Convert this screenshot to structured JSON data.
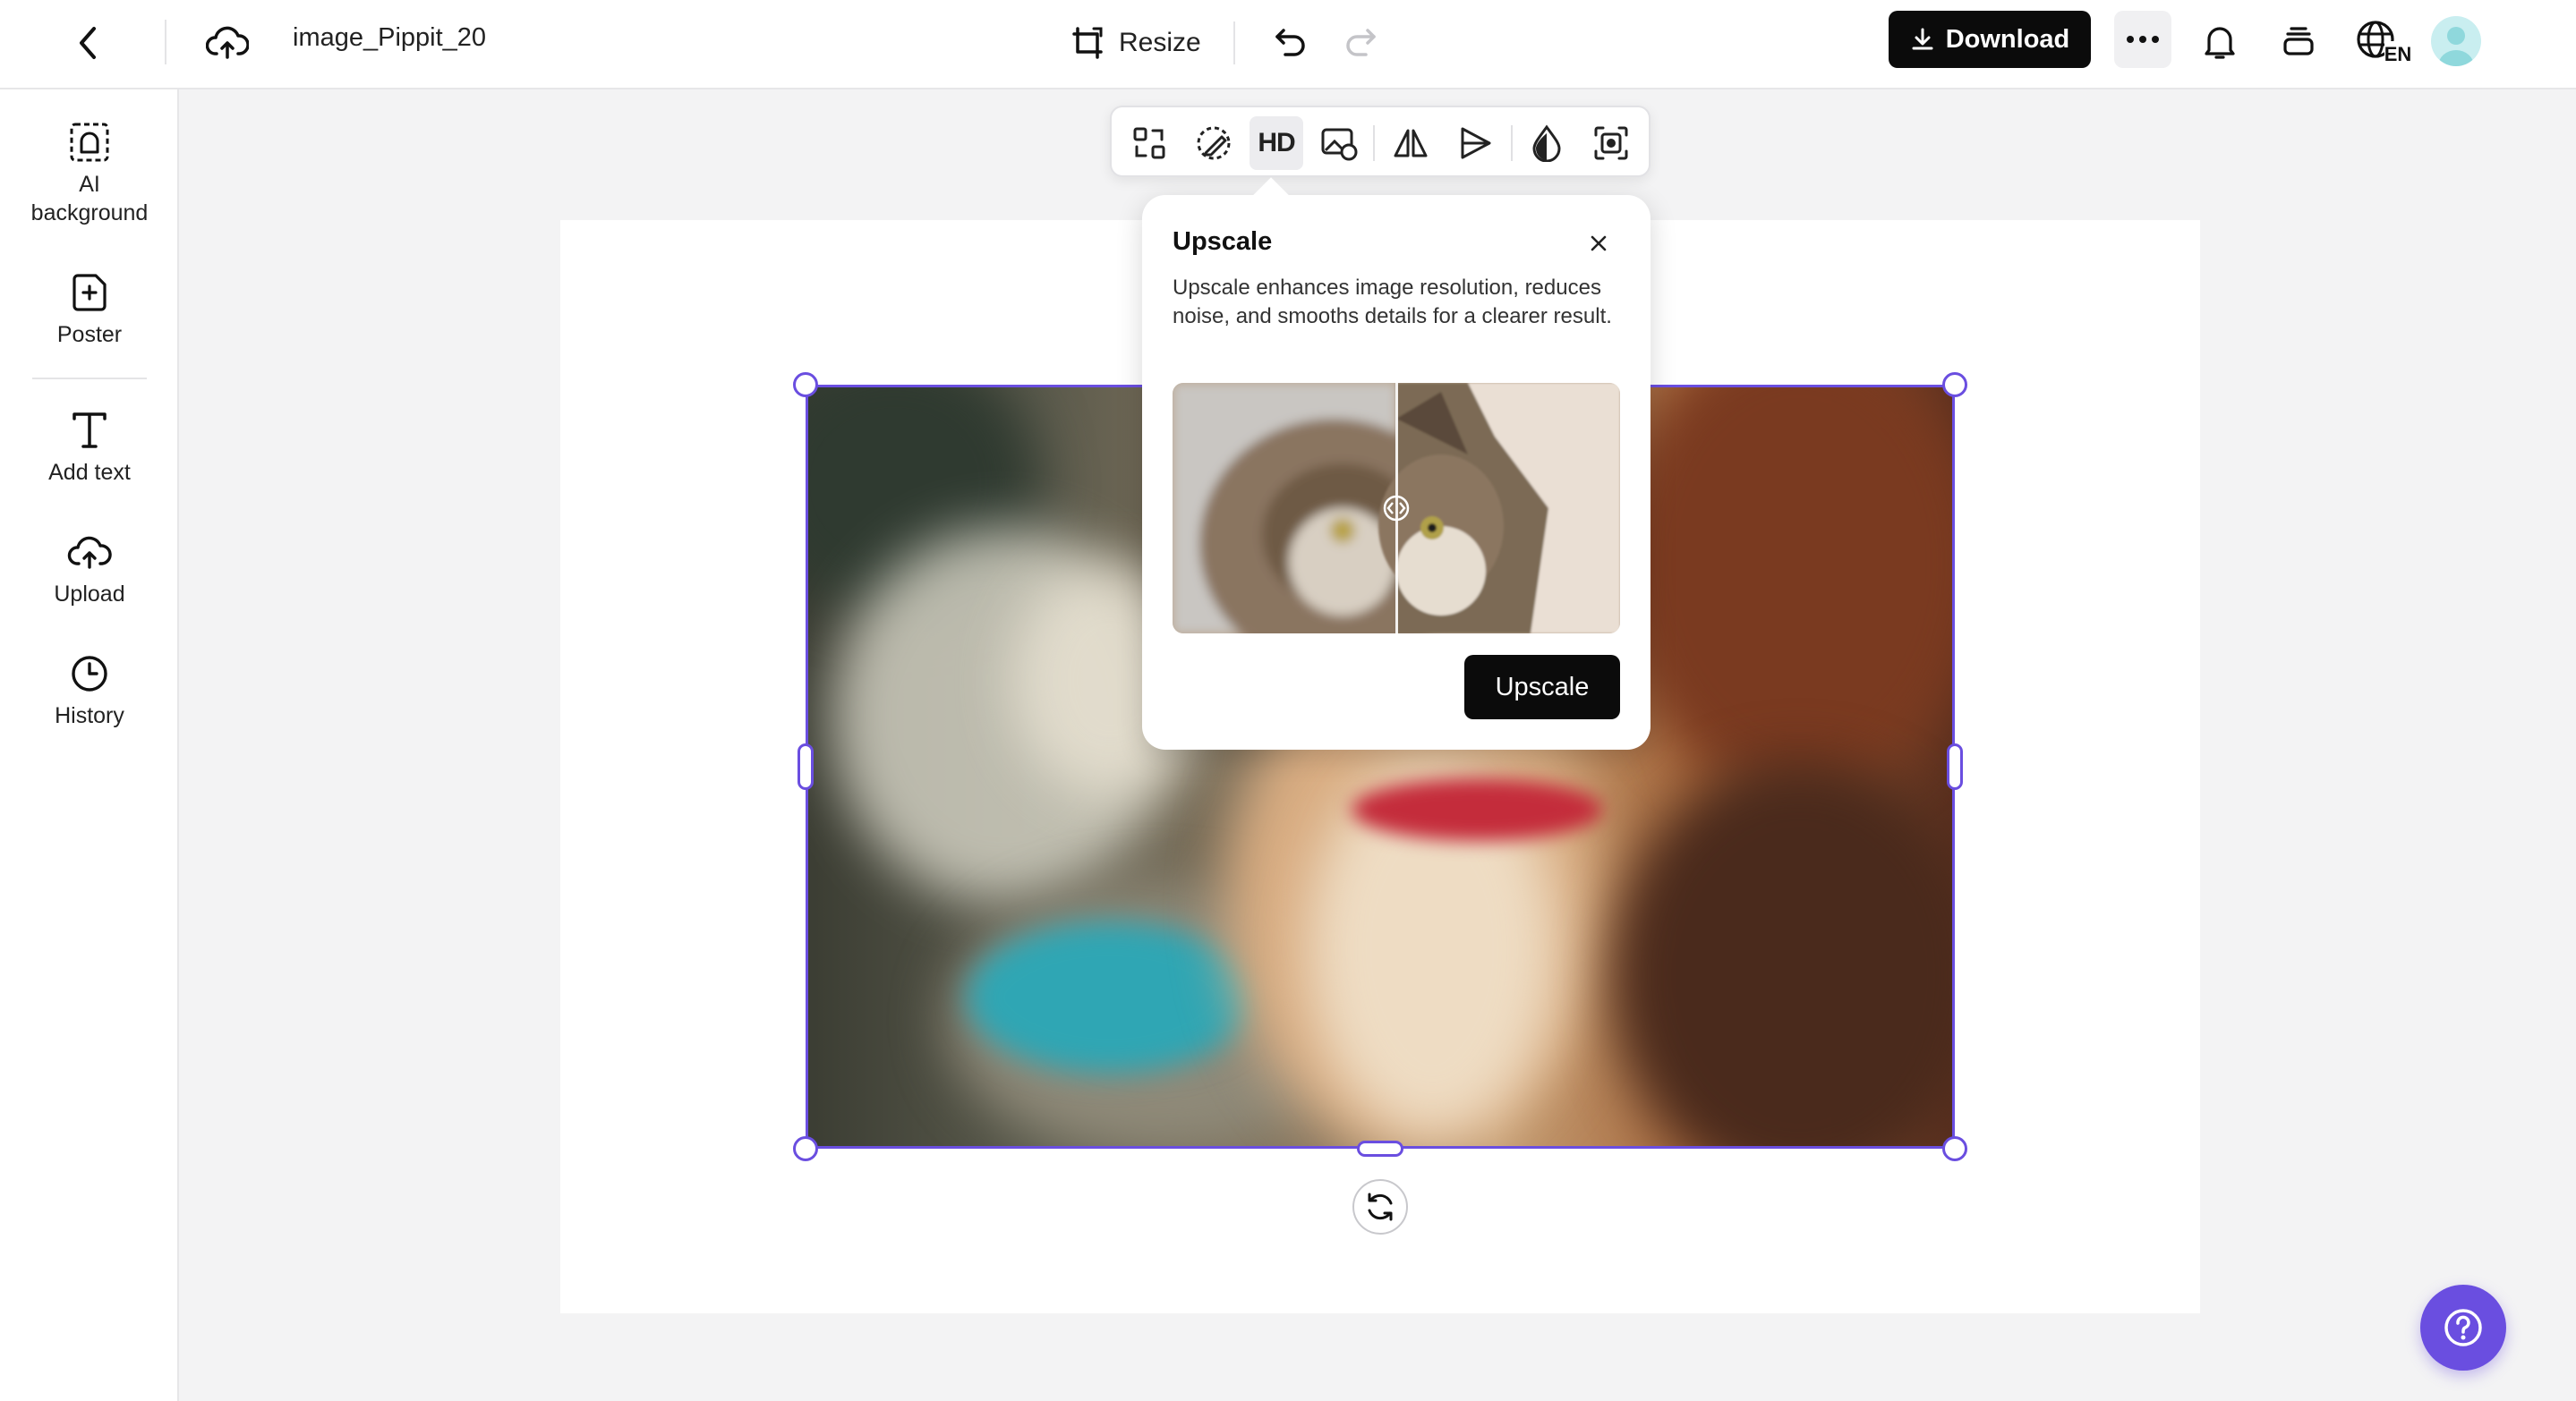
{
  "header": {
    "filename": "image_Pippit_20",
    "resize_label": "Resize",
    "download_label": "Download",
    "language_code": "EN"
  },
  "sidebar": {
    "items": [
      {
        "label_line1": "AI",
        "label_line2": "background",
        "icon": "ai-background-icon"
      },
      {
        "label": "Poster",
        "icon": "poster-icon"
      },
      {
        "label": "Add text",
        "icon": "text-icon"
      },
      {
        "label": "Upload",
        "icon": "upload-cloud-icon"
      },
      {
        "label": "History",
        "icon": "clock-icon"
      }
    ]
  },
  "toolbar": {
    "hd_label": "HD",
    "tools": [
      "swap-icon",
      "eraser-icon",
      "hd-icon",
      "replace-image-icon",
      "flip-icon",
      "send-icon",
      "opacity-icon",
      "crop-icon"
    ]
  },
  "popover": {
    "title": "Upscale",
    "description": "Upscale enhances image resolution, reduces noise, and smooths details for a clearer result.",
    "button_label": "Upscale"
  },
  "colors": {
    "accent": "#6a4ee0",
    "primary_button": "#0b0b0b"
  }
}
